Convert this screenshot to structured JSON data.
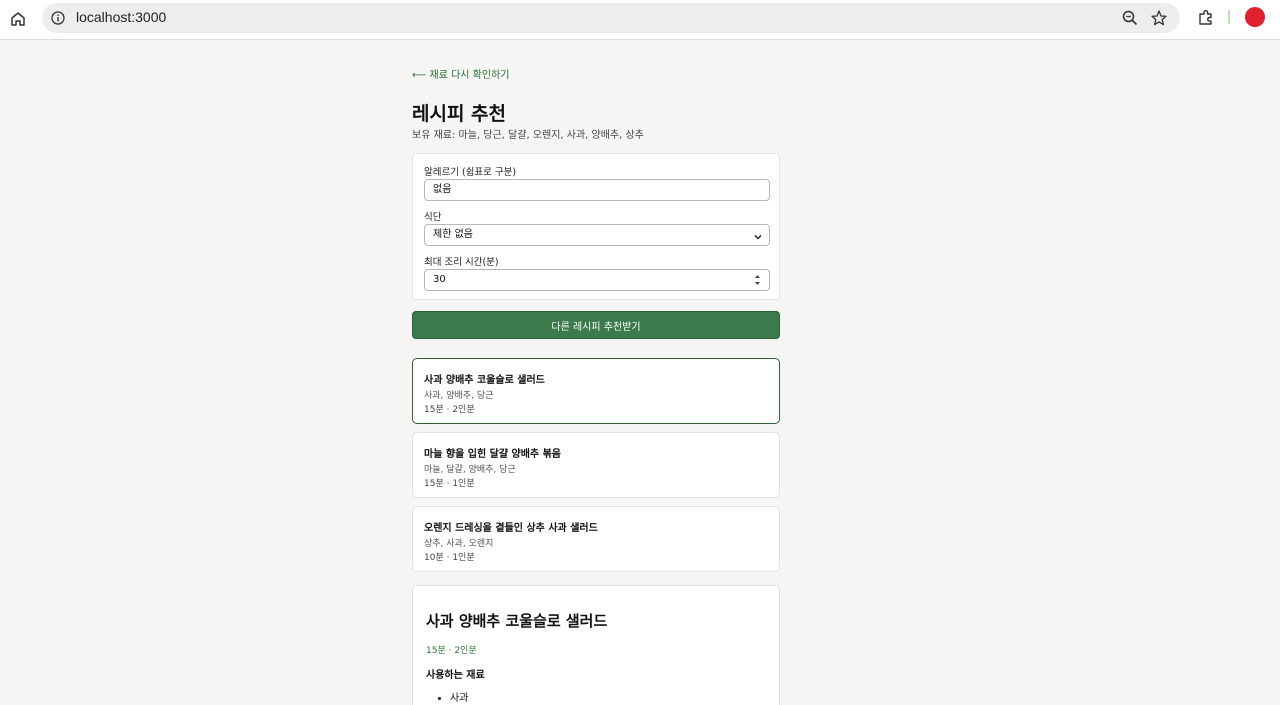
{
  "browser": {
    "url": "localhost:3000"
  },
  "page": {
    "back_link": "⟵ 재료 다시 확인하기",
    "title": "레시피 추천",
    "ingredients_line": "보유 재료: 마늘, 당근, 달걀, 오렌지, 사과, 양배추, 상추"
  },
  "form": {
    "allergy_label": "알레르기 (쉼표로 구분)",
    "allergy_value": "없음",
    "diet_label": "식단",
    "diet_value": "제한 없음",
    "time_label": "최대 조리 시간(분)",
    "time_value": "30"
  },
  "cta_label": "다른 레시피 추천받기",
  "recipes": [
    {
      "title": "사과 양배추 코울슬로 샐러드",
      "ingredients": "사과, 양배추, 당근",
      "meta": "15분 · 2인분",
      "selected": true
    },
    {
      "title": "마늘 향을 입힌 달걀 양배추 볶음",
      "ingredients": "마늘, 달걀, 양배추, 당근",
      "meta": "15분 · 1인분",
      "selected": false
    },
    {
      "title": "오렌지 드레싱을 곁들인 상추 사과 샐러드",
      "ingredients": "상추, 사과, 오렌지",
      "meta": "10분 · 1인분",
      "selected": false
    }
  ],
  "detail": {
    "title": "사과 양배추 코울슬로 샐러드",
    "meta": "15분 · 2인분",
    "section_title": "사용하는 재료",
    "items": [
      "사과"
    ]
  },
  "colors": {
    "accent": "#3b7b4b",
    "selected_border": "#2f5f38",
    "link": "#2e6b36"
  }
}
